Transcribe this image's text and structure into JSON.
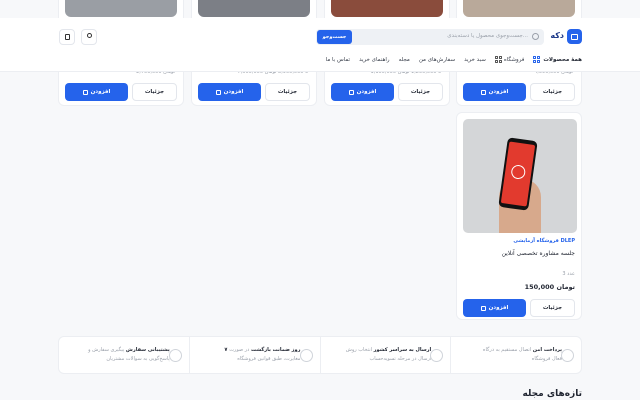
{
  "header": {
    "logo_text": "دکه",
    "search": {
      "placeholder": "جست‌وجوی محصول یا دسته‌بندی...",
      "button": "جست‌وجو"
    },
    "nav": {
      "all_products": "همهٔ محصولات",
      "items": [
        "فروشگاه",
        "سبد خرید",
        "سفارش‌های من",
        "مجله",
        "راهنمای خرید",
        "تماس با ما"
      ]
    }
  },
  "top_products": [
    {
      "price": "4,590,000 تومان",
      "add": "افزودن",
      "details": "جزئیات"
    },
    {
      "price": "1,100,000 تا 1,250,000 تومان",
      "add": "افزودن",
      "details": "جزئیات"
    },
    {
      "price": "7,500,000 تا 8,900,000 تومان",
      "add": "افزودن",
      "details": "جزئیات"
    },
    {
      "price": "2,700,000 تومان",
      "add": "افزودن",
      "details": "جزئیات"
    }
  ],
  "featured": {
    "vendor": "فروشگاه آزمایشی DLEP",
    "name": "جلسه مشاوره تخصصی آنلاین",
    "stock": "3 عدد",
    "price": "150,000 تومان",
    "add": "افزودن",
    "details": "جزئیات"
  },
  "features": [
    {
      "title": "پرداخت امن",
      "desc": "اتصال مستقیم به درگاه فعال فروشگاه"
    },
    {
      "title": "ارسال به سراسر کشور",
      "desc": "انتخاب روش ارسال در مرحله تسویه‌حساب"
    },
    {
      "title": "۷ روز ضمانت بازگشت",
      "desc": "در صورت مغایرت، طبق قوانین فروشگاه"
    },
    {
      "title": "پشتیبانی سفارش",
      "desc": "پیگیری سفارش و پاسخ‌گویی به سوالات مشتریان"
    }
  ],
  "magazine_title": "تازه‌های مجله",
  "colors": {
    "primary": "#2563eb",
    "background": "#f7f8fa"
  }
}
